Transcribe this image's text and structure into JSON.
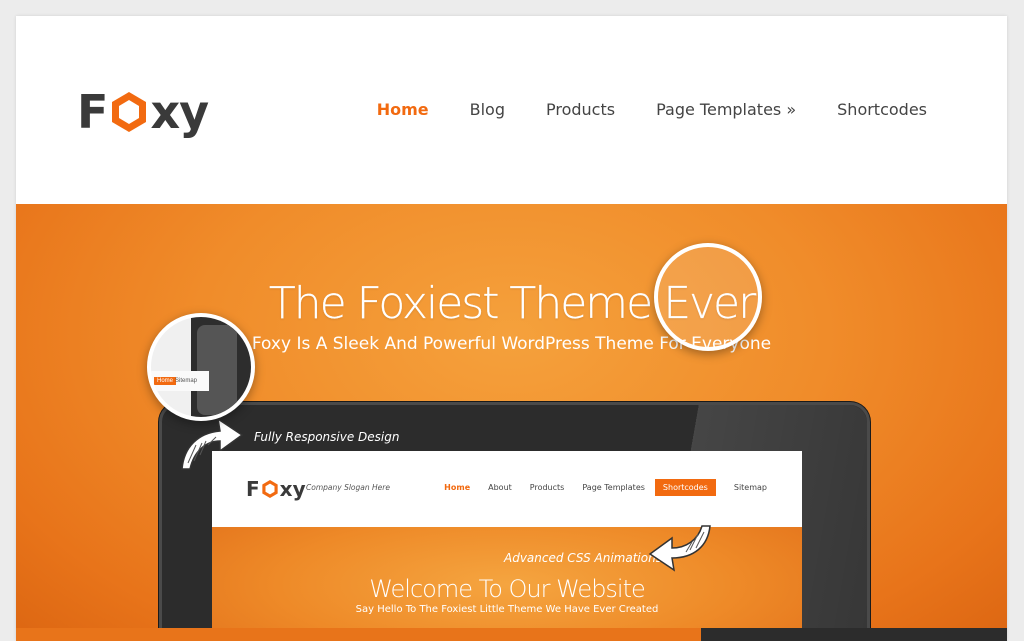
{
  "header": {
    "logo_text_left": "F",
    "logo_text_right": "xy",
    "nav": [
      {
        "label": "Home",
        "active": true
      },
      {
        "label": "Blog",
        "active": false
      },
      {
        "label": "Products",
        "active": false
      },
      {
        "label": "Page Templates »",
        "active": false
      },
      {
        "label": "Shortcodes",
        "active": false
      }
    ]
  },
  "hero": {
    "title": "The Foxiest Theme Ever",
    "subtitle": "Foxy Is A Sleek And Powerful WordPress Theme For Everyone",
    "annotation_responsive": "Fully Responsive Design",
    "annotation_animations": "Advanced CSS Animations"
  },
  "mockup": {
    "logo_left": "F",
    "logo_right": "xy",
    "slogan": "Company Slogan Here",
    "nav": [
      {
        "label": "Home",
        "style": "active"
      },
      {
        "label": "About",
        "style": "normal"
      },
      {
        "label": "Products",
        "style": "normal"
      },
      {
        "label": "Page Templates",
        "style": "normal"
      },
      {
        "label": "Shortcodes",
        "style": "pill"
      },
      {
        "label": "Sitemap",
        "style": "normal"
      }
    ],
    "welcome": "Welcome To Our Website",
    "tagline": "Say Hello To The Foxiest Little Theme We Have Ever Created",
    "zoom_left_pill": "Home",
    "zoom_left_item": "Sitemap"
  },
  "colors": {
    "accent": "#f26a10",
    "hero_orange": "#f08c2a",
    "text_dark": "#3a3a3a"
  }
}
